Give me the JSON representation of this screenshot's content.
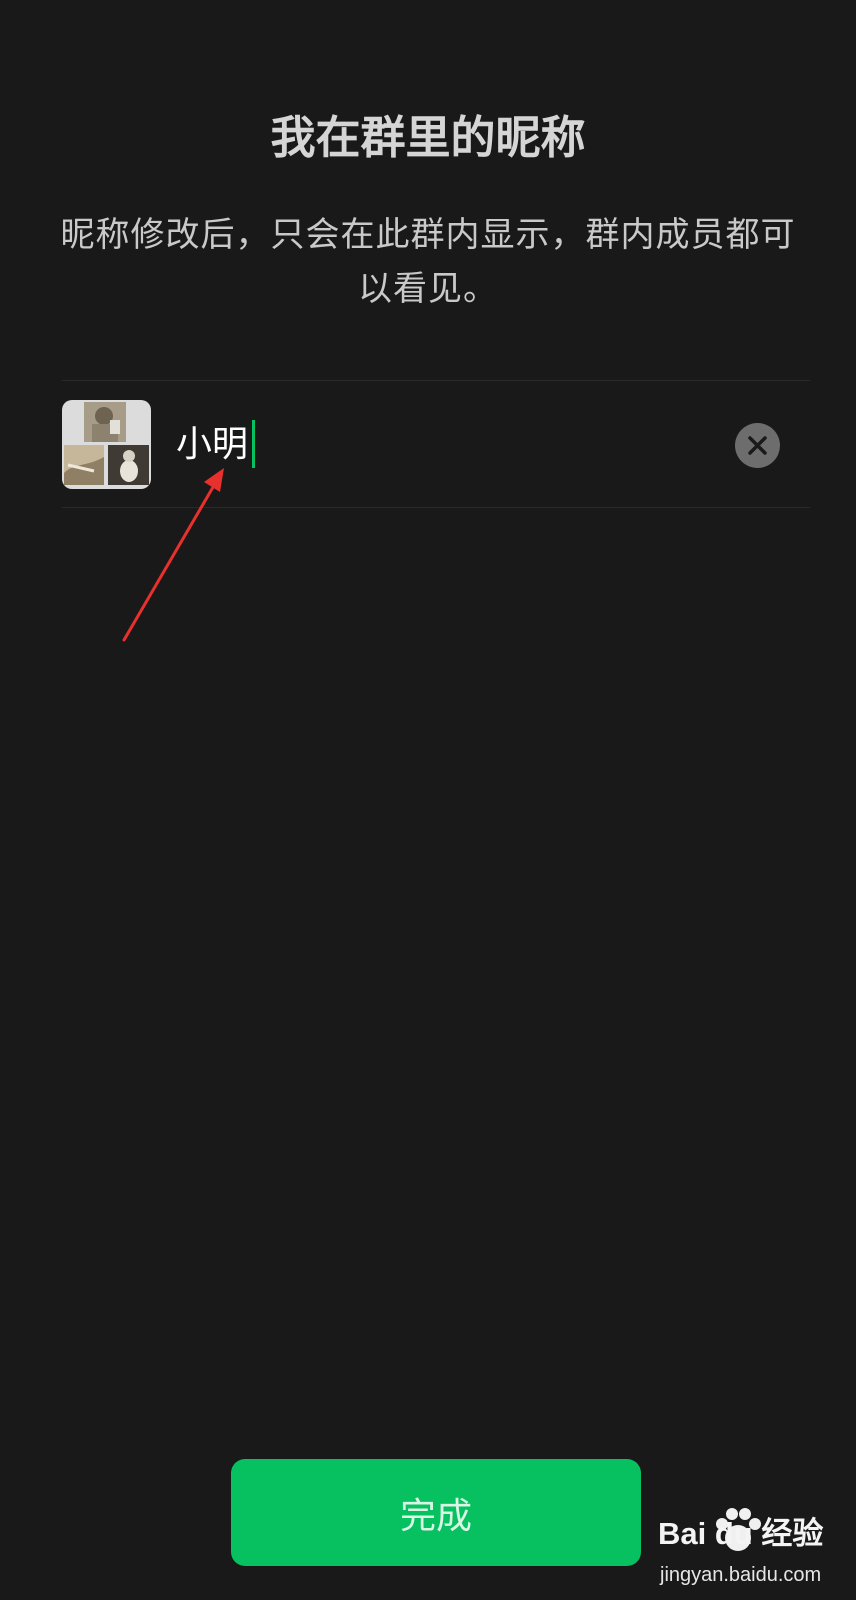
{
  "header": {
    "title": "我在群里的昵称",
    "description": "昵称修改后，只会在此群内显示，群内成员都可以看见。"
  },
  "nickname": {
    "value": "小明",
    "clear_icon": "close-icon",
    "avatar_icon": "group-avatar-collage"
  },
  "annotation": {
    "arrow_color": "#e8302c"
  },
  "footer": {
    "done_label": "完成",
    "accent_color": "#07c160"
  },
  "watermark": {
    "logo": "Bai du 经验",
    "url": "jingyan.baidu.com"
  }
}
